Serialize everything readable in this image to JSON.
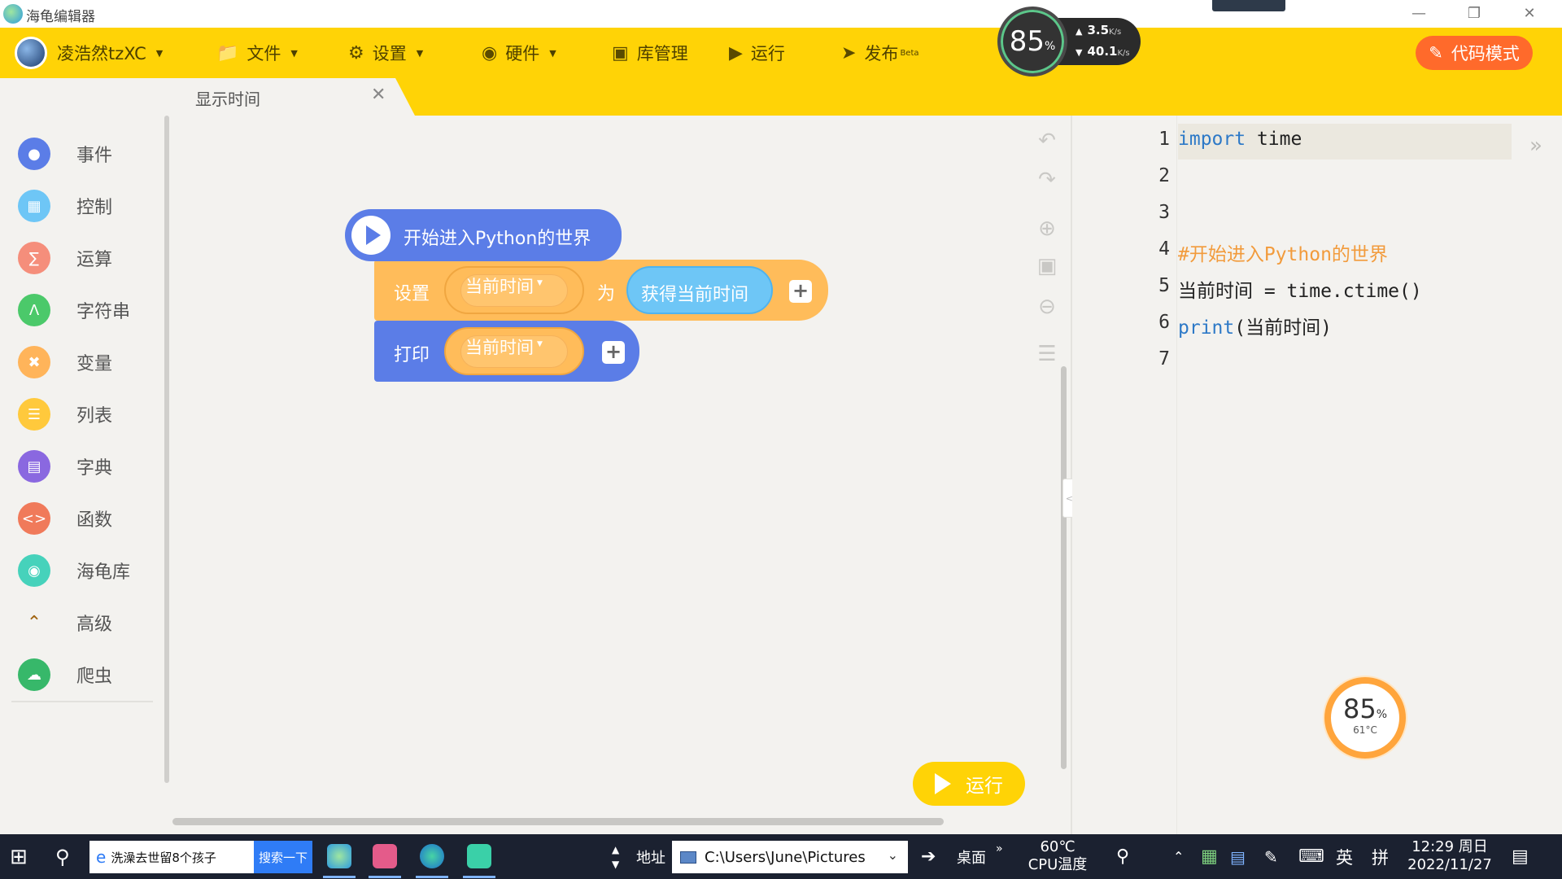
{
  "app": {
    "title": "海龟编辑器"
  },
  "toolbar": {
    "user": "凌浩然tzXC",
    "file": "文件",
    "settings": "设置",
    "hardware": "硬件",
    "library": "库管理",
    "run": "运行",
    "publish": "发布",
    "publish_badge": "Beta",
    "code_mode": "代码模式"
  },
  "perf_widget": {
    "percent": "85",
    "unit": "%",
    "upload": "3.5",
    "upload_unit": "K/s",
    "download": "40.1",
    "download_unit": "K/s"
  },
  "tab": {
    "label": "显示时间"
  },
  "sidebar": {
    "items": [
      {
        "label": "事件",
        "color": "#5b7de7"
      },
      {
        "label": "控制",
        "color": "#6ec6f6"
      },
      {
        "label": "运算",
        "color": "#f58e7b"
      },
      {
        "label": "字符串",
        "color": "#4bc96a"
      },
      {
        "label": "变量",
        "color": "#ffb45a"
      },
      {
        "label": "列表",
        "color": "#ffc93c"
      },
      {
        "label": "字典",
        "color": "#8a68e0"
      },
      {
        "label": "函数",
        "color": "#f07a5a"
      },
      {
        "label": "海龟库",
        "color": "#46d2bb"
      },
      {
        "label": "高级",
        "color": "#a06410"
      },
      {
        "label": "爬虫",
        "color": "#37b86a"
      }
    ]
  },
  "blocks": {
    "hat": "开始进入Python的世界",
    "set_label": "设置",
    "set_var": "当前时间",
    "to_label": "为",
    "get_time": "获得当前时间",
    "print_label": "打印",
    "print_var": "当前时间"
  },
  "workspace": {
    "run_button": "运行"
  },
  "code": {
    "line_numbers": [
      "1",
      "2",
      "3",
      "4",
      "5",
      "6",
      "7"
    ],
    "lines": {
      "l1_kw": "import",
      "l1_rest": " time",
      "l4": "#开始进入Python的世界",
      "l5": "当前时间 = time.ctime()",
      "l6_kw": "print",
      "l6_rest": "(当前时间)"
    }
  },
  "cpu_gauge": {
    "percent": "85",
    "unit": "%",
    "temp": "61°C"
  },
  "taskbar": {
    "search_text": "洗澡去世留8个孩子",
    "search_button": "搜索一下",
    "address_label": "地址",
    "address_value": "C:\\Users\\June\\Pictures",
    "desktop": "桌面",
    "cpu_temp_value": "60℃",
    "cpu_temp_label": "CPU温度",
    "ime_lang": "英",
    "ime_mode": "拼",
    "time": "12:29 周日",
    "date": "2022/11/27"
  }
}
